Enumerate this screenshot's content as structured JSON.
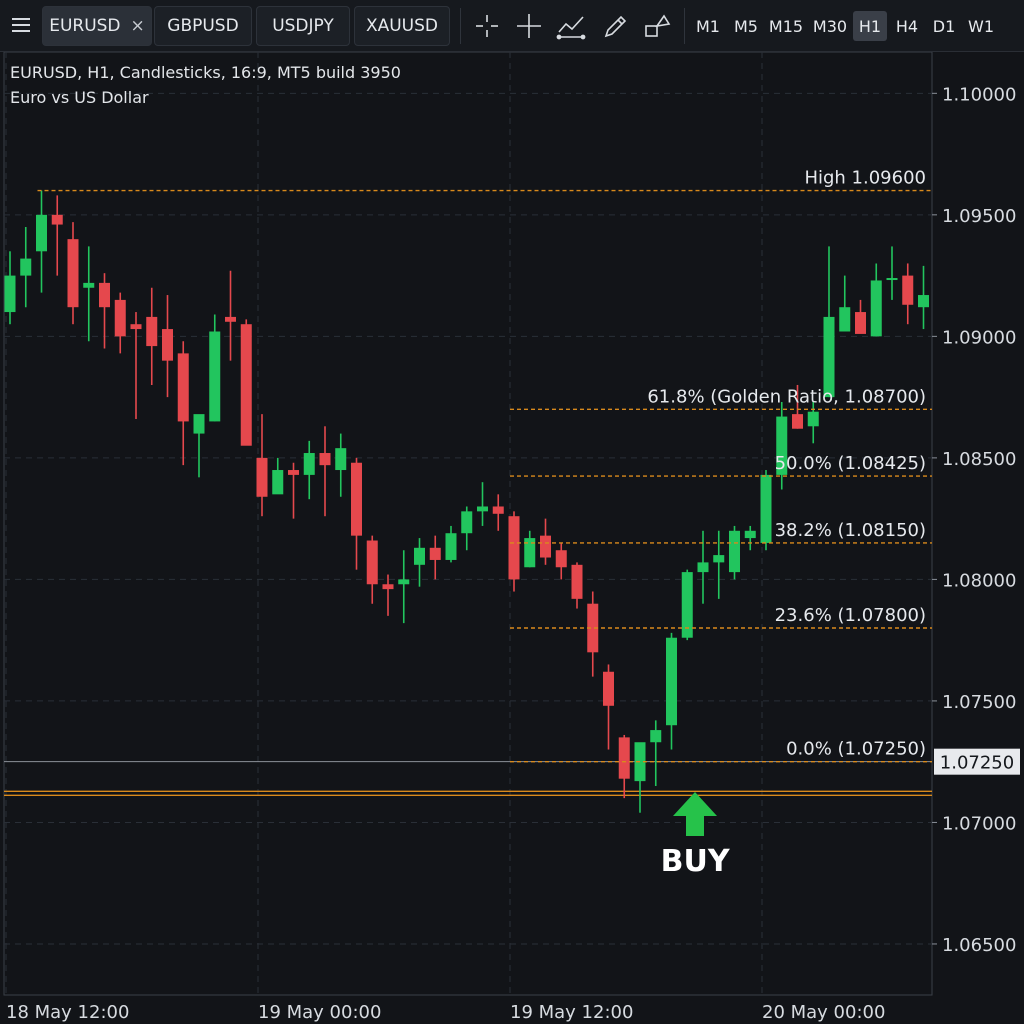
{
  "toolbar": {
    "symbol_tabs": [
      {
        "label": "EURUSD",
        "active": true,
        "closable": true
      },
      {
        "label": "GBPUSD",
        "active": false
      },
      {
        "label": "USDJPY",
        "active": false
      },
      {
        "label": "XAUUSD",
        "active": false
      }
    ],
    "close_glyph": "×",
    "tools": [
      {
        "icon": "crosshair-icon"
      },
      {
        "icon": "crosshair-thin-icon"
      },
      {
        "icon": "trendline-icon"
      },
      {
        "icon": "pencil-icon"
      },
      {
        "icon": "shapes-icon"
      }
    ],
    "timeframes": [
      {
        "label": "M1",
        "active": false
      },
      {
        "label": "M5",
        "active": false
      },
      {
        "label": "M15",
        "active": false
      },
      {
        "label": "M30",
        "active": false
      },
      {
        "label": "H1",
        "active": true
      },
      {
        "label": "H4",
        "active": false
      },
      {
        "label": "D1",
        "active": false
      },
      {
        "label": "W1",
        "active": false
      }
    ]
  },
  "chart_info": {
    "line1": "EURUSD, H1, Candlesticks, 16:9, MT5 build 3950",
    "line2": "Euro vs US Dollar"
  },
  "buy_signal": {
    "label": "BUY",
    "color": "#26c24a"
  },
  "colors": {
    "bull": "#22c55e",
    "bear": "#e5484d",
    "fib": "#d98a1c",
    "grid": "#2a2f37",
    "background": "#121418"
  },
  "chart_data": {
    "type": "candlestick",
    "title": "EURUSD, H1, Candlesticks, 16:9, MT5 build 3950",
    "subtitle": "Euro vs US Dollar",
    "ylim": [
      1.0629,
      1.1017
    ],
    "y_ticks": [
      "1.10000",
      "1.09500",
      "1.09000",
      "1.08500",
      "1.08000",
      "1.07500",
      "1.07000",
      "1.06500"
    ],
    "x_ticks": [
      "18 May 12:00",
      "19 May 00:00",
      "19 May 12:00",
      "20 May 00:00"
    ],
    "x_tick_bar_index": [
      0,
      16,
      32,
      48
    ],
    "current_price_label": "1.07250",
    "current_price": 1.0725,
    "horizontal_lines": [
      {
        "label": "High 1.09600",
        "price": 1.096,
        "from_bar": 2
      },
      {
        "label": "61.8% (Golden Ratio, 1.08700)",
        "price": 1.087,
        "from_bar": 32
      },
      {
        "label": "50.0% (1.08425)",
        "price": 1.08425,
        "from_bar": 32
      },
      {
        "label": "38.2% (1.08150)",
        "price": 1.0815,
        "from_bar": 32
      },
      {
        "label": "23.6% (1.07800)",
        "price": 1.078,
        "from_bar": 32
      },
      {
        "label": "0.0% (1.07250)",
        "price": 1.0725,
        "from_bar": 32
      }
    ],
    "support_price": 1.0712,
    "buy_bar_index": 43.5,
    "candles": [
      {
        "o": 1.091,
        "h": 1.0935,
        "l": 1.0905,
        "c": 1.0925
      },
      {
        "o": 1.0925,
        "h": 1.0945,
        "l": 1.0912,
        "c": 1.0932
      },
      {
        "o": 1.0935,
        "h": 1.096,
        "l": 1.0918,
        "c": 1.095
      },
      {
        "o": 1.095,
        "h": 1.0958,
        "l": 1.0925,
        "c": 1.0946
      },
      {
        "o": 1.094,
        "h": 1.0947,
        "l": 1.0905,
        "c": 1.0912
      },
      {
        "o": 1.092,
        "h": 1.0937,
        "l": 1.0898,
        "c": 1.0922
      },
      {
        "o": 1.0922,
        "h": 1.0926,
        "l": 1.0895,
        "c": 1.0912
      },
      {
        "o": 1.0915,
        "h": 1.0918,
        "l": 1.0893,
        "c": 1.09
      },
      {
        "o": 1.0905,
        "h": 1.091,
        "l": 1.0866,
        "c": 1.0903
      },
      {
        "o": 1.0908,
        "h": 1.092,
        "l": 1.088,
        "c": 1.0896
      },
      {
        "o": 1.0903,
        "h": 1.0917,
        "l": 1.0875,
        "c": 1.089
      },
      {
        "o": 1.0893,
        "h": 1.0898,
        "l": 1.0847,
        "c": 1.0865
      },
      {
        "o": 1.086,
        "h": 1.0865,
        "l": 1.0842,
        "c": 1.0868
      },
      {
        "o": 1.0865,
        "h": 1.0909,
        "l": 1.0865,
        "c": 1.0902
      },
      {
        "o": 1.0908,
        "h": 1.0927,
        "l": 1.089,
        "c": 1.0906
      },
      {
        "o": 1.0905,
        "h": 1.0907,
        "l": 1.0864,
        "c": 1.0855
      },
      {
        "o": 1.085,
        "h": 1.0868,
        "l": 1.0826,
        "c": 1.0834
      },
      {
        "o": 1.0835,
        "h": 1.085,
        "l": 1.0842,
        "c": 1.0845
      },
      {
        "o": 1.0845,
        "h": 1.0848,
        "l": 1.0825,
        "c": 1.0843
      },
      {
        "o": 1.0843,
        "h": 1.0857,
        "l": 1.0833,
        "c": 1.0852
      },
      {
        "o": 1.0852,
        "h": 1.0863,
        "l": 1.0826,
        "c": 1.0847
      },
      {
        "o": 1.0845,
        "h": 1.086,
        "l": 1.0834,
        "c": 1.0854
      },
      {
        "o": 1.0848,
        "h": 1.085,
        "l": 1.0804,
        "c": 1.0818
      },
      {
        "o": 1.0816,
        "h": 1.0818,
        "l": 1.079,
        "c": 1.0798
      },
      {
        "o": 1.0798,
        "h": 1.0802,
        "l": 1.0785,
        "c": 1.0796
      },
      {
        "o": 1.0798,
        "h": 1.0812,
        "l": 1.0782,
        "c": 1.08
      },
      {
        "o": 1.0806,
        "h": 1.0817,
        "l": 1.0797,
        "c": 1.0813
      },
      {
        "o": 1.0813,
        "h": 1.0818,
        "l": 1.08,
        "c": 1.0808
      },
      {
        "o": 1.0808,
        "h": 1.0822,
        "l": 1.0807,
        "c": 1.0819
      },
      {
        "o": 1.0819,
        "h": 1.083,
        "l": 1.0812,
        "c": 1.0828
      },
      {
        "o": 1.0828,
        "h": 1.084,
        "l": 1.0822,
        "c": 1.083
      },
      {
        "o": 1.083,
        "h": 1.0835,
        "l": 1.082,
        "c": 1.0827
      },
      {
        "o": 1.0826,
        "h": 1.0828,
        "l": 1.0795,
        "c": 1.08
      },
      {
        "o": 1.0805,
        "h": 1.082,
        "l": 1.0805,
        "c": 1.0817
      },
      {
        "o": 1.0818,
        "h": 1.0825,
        "l": 1.0806,
        "c": 1.0809
      },
      {
        "o": 1.0812,
        "h": 1.0815,
        "l": 1.08,
        "c": 1.0805
      },
      {
        "o": 1.0806,
        "h": 1.0807,
        "l": 1.0788,
        "c": 1.0792
      },
      {
        "o": 1.079,
        "h": 1.0795,
        "l": 1.076,
        "c": 1.077
      },
      {
        "o": 1.0762,
        "h": 1.0765,
        "l": 1.073,
        "c": 1.0748
      },
      {
        "o": 1.0735,
        "h": 1.0736,
        "l": 1.071,
        "c": 1.0718
      },
      {
        "o": 1.0717,
        "h": 1.0732,
        "l": 1.0704,
        "c": 1.0733
      },
      {
        "o": 1.0733,
        "h": 1.0742,
        "l": 1.0715,
        "c": 1.0738
      },
      {
        "o": 1.074,
        "h": 1.0778,
        "l": 1.073,
        "c": 1.0776
      },
      {
        "o": 1.0776,
        "h": 1.0804,
        "l": 1.0775,
        "c": 1.0803
      },
      {
        "o": 1.0803,
        "h": 1.082,
        "l": 1.079,
        "c": 1.0807
      },
      {
        "o": 1.0807,
        "h": 1.082,
        "l": 1.0792,
        "c": 1.081
      },
      {
        "o": 1.0803,
        "h": 1.0822,
        "l": 1.08,
        "c": 1.082
      },
      {
        "o": 1.0817,
        "h": 1.0822,
        "l": 1.0812,
        "c": 1.082
      },
      {
        "o": 1.0815,
        "h": 1.0845,
        "l": 1.0812,
        "c": 1.0843
      },
      {
        "o": 1.0843,
        "h": 1.0873,
        "l": 1.0837,
        "c": 1.0867
      },
      {
        "o": 1.0868,
        "h": 1.088,
        "l": 1.0862,
        "c": 1.0862
      },
      {
        "o": 1.0863,
        "h": 1.0873,
        "l": 1.0856,
        "c": 1.0869
      },
      {
        "o": 1.0875,
        "h": 1.0937,
        "l": 1.0875,
        "c": 1.0908
      },
      {
        "o": 1.0902,
        "h": 1.0925,
        "l": 1.0902,
        "c": 1.0912
      },
      {
        "o": 1.091,
        "h": 1.0915,
        "l": 1.0902,
        "c": 1.0901
      },
      {
        "o": 1.09,
        "h": 1.093,
        "l": 1.09,
        "c": 1.0923
      },
      {
        "o": 1.0924,
        "h": 1.0937,
        "l": 1.0915,
        "c": 1.0924
      },
      {
        "o": 1.0925,
        "h": 1.093,
        "l": 1.0905,
        "c": 1.0913
      },
      {
        "o": 1.0912,
        "h": 1.0929,
        "l": 1.0903,
        "c": 1.0917
      }
    ]
  }
}
